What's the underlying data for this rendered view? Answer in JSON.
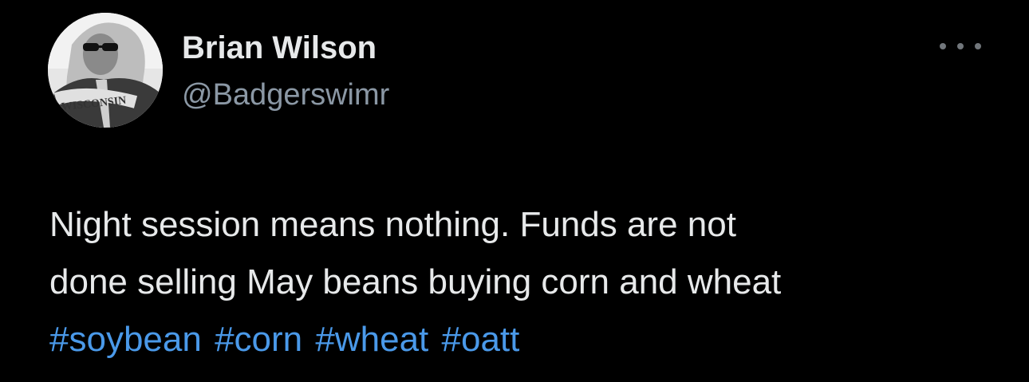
{
  "user": {
    "display_name": "Brian Wilson",
    "handle": "@Badgerswimr",
    "avatar_text": "WISCONSIN"
  },
  "tweet": {
    "lines": [
      "Night session means nothing. Funds are not",
      "done selling May beans buying corn and wheat"
    ],
    "hashtags": [
      "#soybean",
      "#corn",
      "#wheat",
      "#oatt"
    ]
  },
  "more_icon": "more-horizontal-icon",
  "colors": {
    "background": "#000000",
    "text": "#e7e9ea",
    "secondary": "#8b98a5",
    "link": "#4a99e9"
  }
}
